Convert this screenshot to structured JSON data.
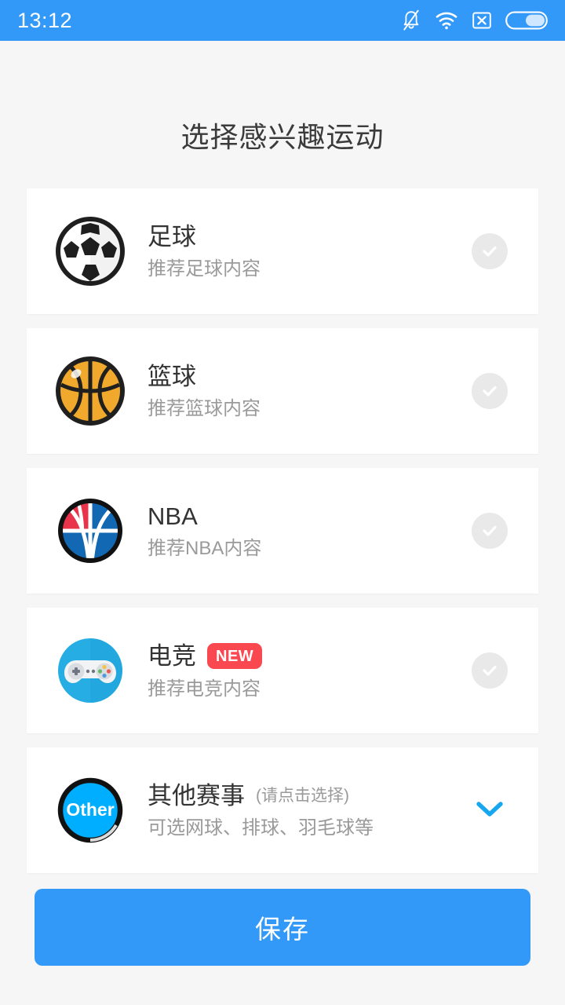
{
  "status_bar": {
    "time": "13:12",
    "icons": [
      "bell-muted-icon",
      "wifi-icon",
      "sim-none-icon",
      "battery-icon"
    ],
    "background_color": "#3399f8"
  },
  "page": {
    "title": "选择感兴趣运动",
    "background_color": "#f6f6f6"
  },
  "cards": [
    {
      "id": "soccer",
      "icon": "soccer-ball-icon",
      "title": "足球",
      "subtitle": "推荐足球内容",
      "badge": null,
      "note": null,
      "action": "check-circle",
      "selected": false
    },
    {
      "id": "basketball",
      "icon": "basketball-icon",
      "title": "篮球",
      "subtitle": "推荐篮球内容",
      "badge": null,
      "note": null,
      "action": "check-circle",
      "selected": false
    },
    {
      "id": "nba",
      "icon": "nba-ball-icon",
      "title": "NBA",
      "subtitle": "推荐NBA内容",
      "badge": null,
      "note": null,
      "action": "check-circle",
      "selected": false
    },
    {
      "id": "esports",
      "icon": "gamepad-icon",
      "title": "电竞",
      "subtitle": "推荐电竞内容",
      "badge": "NEW",
      "note": null,
      "action": "check-circle",
      "selected": false
    },
    {
      "id": "other",
      "icon": "other-ball-icon",
      "title": "其他赛事",
      "subtitle": "可选网球、排球、羽毛球等",
      "badge": null,
      "note": "(请点击选择)",
      "action": "chevron-down",
      "selected": false
    }
  ],
  "footer": {
    "save_label": "保存"
  },
  "colors": {
    "accent": "#3399f8",
    "badge_red": "#f9484f",
    "title_text": "#333333",
    "sub_text": "#9a9a9a",
    "check_unselected": "#e9e9e9",
    "chevron_blue": "#16a7f0",
    "other_icon_blue": "#00aeff",
    "basketball_orange": "#f0a92c",
    "nba_red": "#e8334a",
    "nba_blue": "#1268b3",
    "esports_blue": "#25ade4"
  }
}
